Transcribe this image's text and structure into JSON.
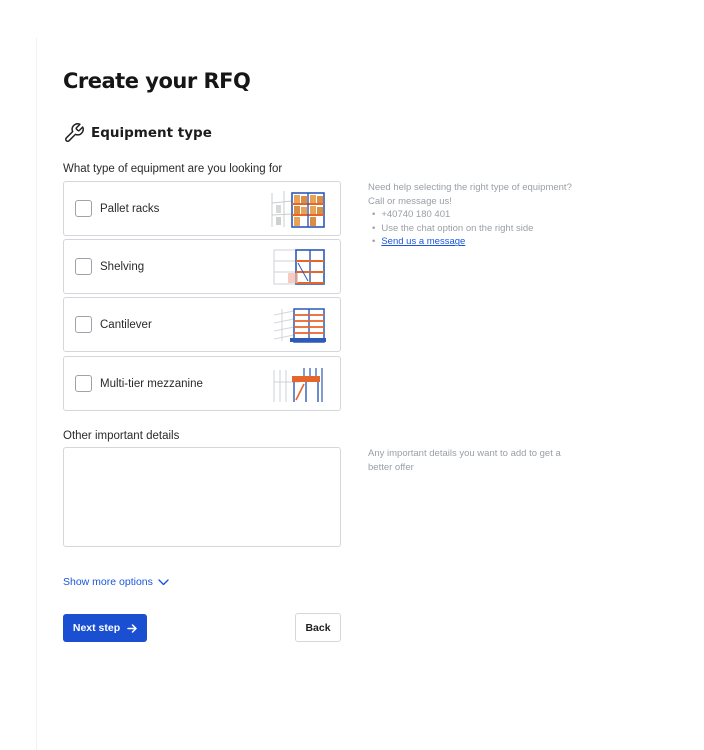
{
  "page": {
    "title": "Create your RFQ"
  },
  "section": {
    "title": "Equipment type",
    "icon": "wrench-icon"
  },
  "equipment": {
    "question": "What type of equipment are you looking for",
    "options": [
      {
        "label": "Pallet racks",
        "checked": false,
        "image": "pallet-racks-image"
      },
      {
        "label": "Shelving",
        "checked": false,
        "image": "shelving-image"
      },
      {
        "label": "Cantilever",
        "checked": false,
        "image": "cantilever-image"
      },
      {
        "label": "Multi-tier mezzanine",
        "checked": false,
        "image": "mezzanine-image"
      }
    ],
    "help": {
      "intro": "Need help selecting the right type of equipment? Call or message us!",
      "phone": "+40740 180 401",
      "chat": "Use the chat option on the right side",
      "message_link": "Send us a message"
    }
  },
  "details": {
    "label": "Other important details",
    "value": "",
    "help": "Any important details you want to add to get a better offer"
  },
  "more_options": {
    "label": "Show more options"
  },
  "actions": {
    "next_label": "Next step",
    "back_label": "Back"
  },
  "colors": {
    "accent": "#1a4fd1",
    "link": "#1a56db",
    "border": "#d4d6db",
    "muted": "#9aa0a6"
  }
}
